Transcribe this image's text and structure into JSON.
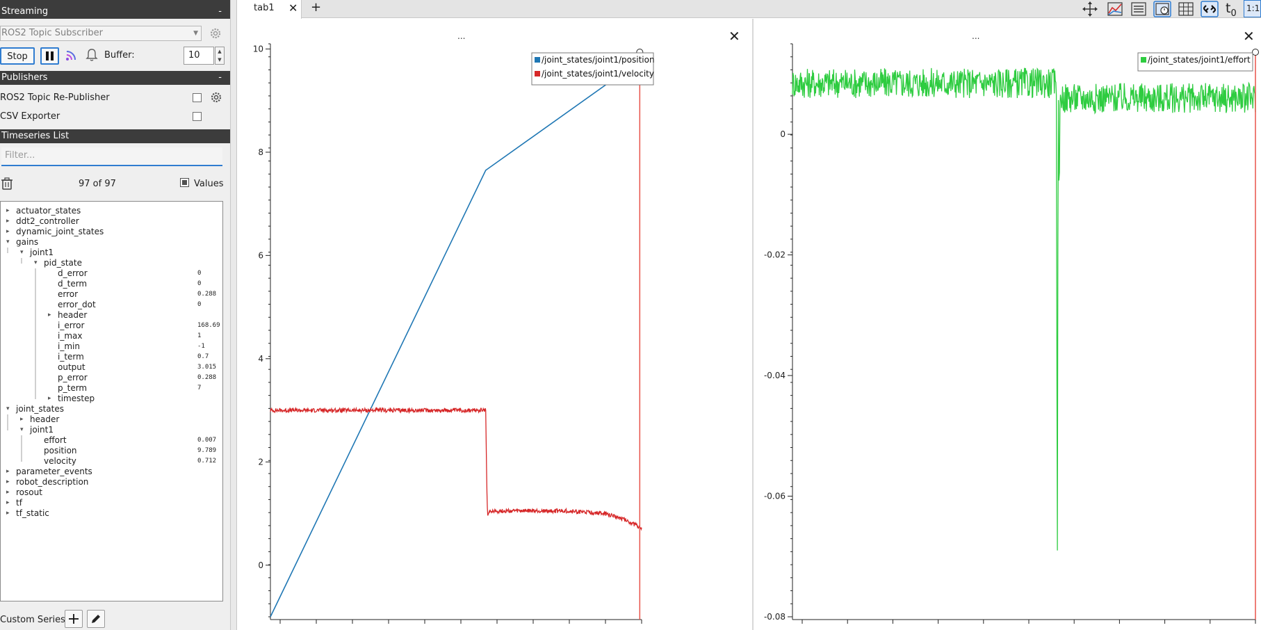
{
  "sidebar": {
    "streaming": {
      "title": "Streaming",
      "collapse": "-",
      "source": "ROS2 Topic Subscriber",
      "stop_label": "Stop",
      "buffer_label": "Buffer:",
      "buffer_value": "10"
    },
    "publishers": {
      "title": "Publishers",
      "collapse": "-",
      "items": [
        {
          "label": "ROS2 Topic Re-Publisher",
          "checked": false
        },
        {
          "label": "CSV Exporter",
          "checked": false
        }
      ]
    },
    "timeseries": {
      "title": "Timeseries List",
      "filter_placeholder": "Filter...",
      "count": "97 of 97",
      "values_label": "Values"
    },
    "tree": [
      {
        "label": "actuator_states",
        "depth": 0,
        "arrow": "collapsed"
      },
      {
        "label": "ddt2_controller",
        "depth": 0,
        "arrow": "collapsed"
      },
      {
        "label": "dynamic_joint_states",
        "depth": 0,
        "arrow": "collapsed"
      },
      {
        "label": "gains",
        "depth": 0,
        "arrow": "expanded"
      },
      {
        "label": "joint1",
        "depth": 1,
        "arrow": "expanded"
      },
      {
        "label": "pid_state",
        "depth": 2,
        "arrow": "expanded"
      },
      {
        "label": "d_error",
        "depth": 3,
        "value": "0"
      },
      {
        "label": "d_term",
        "depth": 3,
        "value": "0"
      },
      {
        "label": "error",
        "depth": 3,
        "value": "0.288"
      },
      {
        "label": "error_dot",
        "depth": 3,
        "value": "0"
      },
      {
        "label": "header",
        "depth": 3,
        "arrow": "collapsed"
      },
      {
        "label": "i_error",
        "depth": 3,
        "value": "168.69"
      },
      {
        "label": "i_max",
        "depth": 3,
        "value": "1"
      },
      {
        "label": "i_min",
        "depth": 3,
        "value": "-1"
      },
      {
        "label": "i_term",
        "depth": 3,
        "value": "0.7"
      },
      {
        "label": "output",
        "depth": 3,
        "value": "3.015"
      },
      {
        "label": "p_error",
        "depth": 3,
        "value": "0.288"
      },
      {
        "label": "p_term",
        "depth": 3,
        "value": "7"
      },
      {
        "label": "timestep",
        "depth": 3,
        "arrow": "collapsed"
      },
      {
        "label": "joint_states",
        "depth": 0,
        "arrow": "expanded"
      },
      {
        "label": "header",
        "depth": 1,
        "arrow": "collapsed"
      },
      {
        "label": "joint1",
        "depth": 1,
        "arrow": "expanded"
      },
      {
        "label": "effort",
        "depth": 2,
        "value": "0.007"
      },
      {
        "label": "position",
        "depth": 2,
        "value": "9.789"
      },
      {
        "label": "velocity",
        "depth": 2,
        "value": "0.712"
      },
      {
        "label": "parameter_events",
        "depth": 0,
        "arrow": "collapsed"
      },
      {
        "label": "robot_description",
        "depth": 0,
        "arrow": "collapsed"
      },
      {
        "label": "rosout",
        "depth": 0,
        "arrow": "collapsed"
      },
      {
        "label": "tf",
        "depth": 0,
        "arrow": "collapsed"
      },
      {
        "label": "tf_static",
        "depth": 0,
        "arrow": "collapsed"
      }
    ],
    "custom_series_label": "Custom Series:"
  },
  "tabs": [
    {
      "label": "tab1",
      "active": true
    }
  ],
  "add_tab_label": "+",
  "toolbar_icons": [
    "move-icon",
    "zoom-chart-icon",
    "list-icon",
    "clock-settings-icon",
    "grid-icon",
    "link-icon",
    "t0-icon",
    "ratio-icon"
  ],
  "toolbar_text": {
    "t0": "t",
    "t0_sub": "0",
    "ratio": "1:1"
  },
  "colors": {
    "position": "#1f77b4",
    "velocity": "#d62728",
    "effort": "#2ecc40",
    "cursor": "#e8534a",
    "accent": "#2f7cd0"
  },
  "chart_data": [
    {
      "type": "line",
      "title": "...",
      "ylim": [
        -1.0,
        10.1
      ],
      "yticks": [
        "0",
        "2",
        "4",
        "6",
        "8",
        "10"
      ],
      "ytick_values": [
        0,
        2,
        4,
        6,
        8,
        10
      ],
      "xlim": [
        0,
        1
      ],
      "legend": "top-right",
      "series": [
        {
          "name": "/joint_states/joint1/position",
          "color": "#1f77b4",
          "x": [
            0.0,
            0.58,
            1.0
          ],
          "y": [
            -1.0,
            7.65,
            9.8
          ]
        },
        {
          "name": "/joint_states/joint1/velocity",
          "color": "#d62728",
          "x": [
            0.0,
            0.58,
            0.583,
            0.585,
            0.59,
            0.8,
            0.9,
            0.95,
            1.0
          ],
          "y": [
            3.0,
            3.0,
            1.5,
            0.95,
            1.05,
            1.05,
            1.0,
            0.9,
            0.72
          ]
        }
      ],
      "cursor_x": 0.995
    },
    {
      "type": "line",
      "title": "...",
      "ylim": [
        -0.08,
        0.015
      ],
      "yticks": [
        "0",
        "-0.02",
        "-0.04",
        "-0.06",
        "-0.08"
      ],
      "ytick_values": [
        0,
        -0.02,
        -0.04,
        -0.06,
        -0.08
      ],
      "xlim": [
        0,
        1
      ],
      "legend": "top-right",
      "series": [
        {
          "name": "/joint_states/joint1/effort",
          "color": "#2ecc40",
          "x": [
            0.0,
            0.57,
            0.572,
            0.574,
            0.576,
            0.578,
            0.58,
            1.0
          ],
          "y": [
            0.0085,
            0.0085,
            -0.079,
            0.011,
            -0.013,
            0.007,
            0.006,
            0.006
          ]
        }
      ],
      "cursor_x": 1.0
    }
  ]
}
